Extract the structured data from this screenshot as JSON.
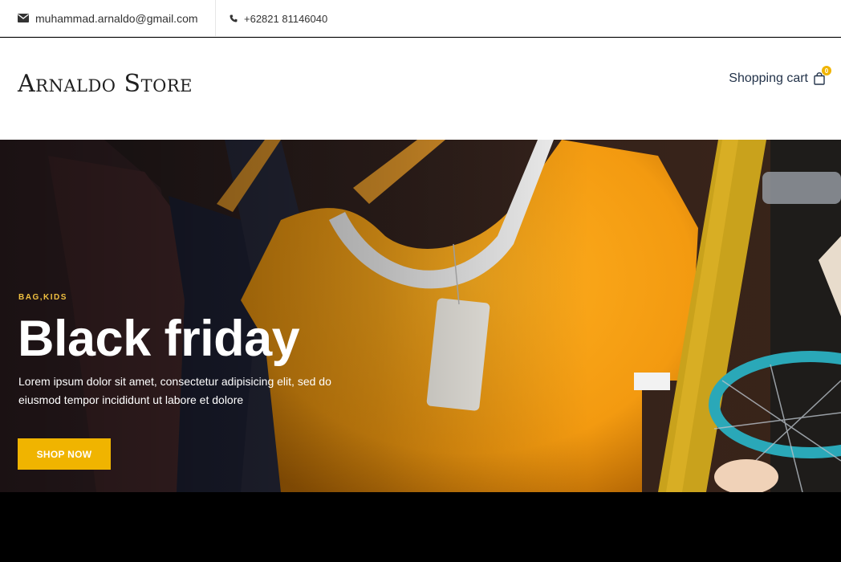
{
  "topbar": {
    "email": "muhammad.arnaldo@gmail.com",
    "phone": "+62821 81146040",
    "email_icon": "envelope-icon",
    "phone_icon": "phone-icon"
  },
  "header": {
    "logo": "Arnaldo Store",
    "cart_label": "Shopping cart",
    "cart_count": "0",
    "cart_icon": "shopping-bag-icon"
  },
  "hero": {
    "category": "BAG,KIDS",
    "title": "Black friday",
    "description": "Lorem ipsum dolor sit amet, consectetur adipisicing elit, sed do eiusmod tempor incididunt ut labore et dolore",
    "button_label": "SHOP NOW"
  },
  "colors": {
    "accent": "#f0b400",
    "category_text": "#f0c040"
  }
}
